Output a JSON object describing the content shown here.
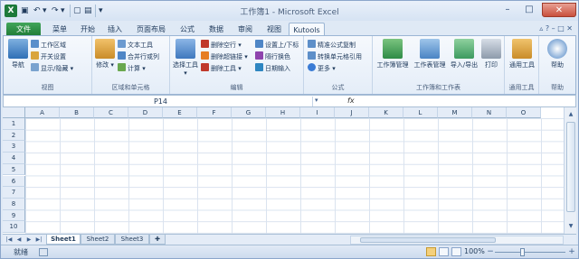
{
  "window": {
    "title": "工作簿1 - Microsoft Excel"
  },
  "titlebar": {
    "app_icon": "excel-icon",
    "undo": "↶",
    "redo": "↷",
    "minimize": "–",
    "maximize": "□",
    "close": "✕"
  },
  "tabs": [
    "文件",
    "菜单",
    "开始",
    "插入",
    "页面布局",
    "公式",
    "数据",
    "审阅",
    "视图",
    "Kutools"
  ],
  "ribbon": {
    "view_group": {
      "label": "视图",
      "big": "导航",
      "items": [
        "工作区域",
        "开关设置",
        "显示/隐藏"
      ]
    },
    "range_group": {
      "label": "区域和单元格",
      "big": "修改",
      "items": [
        "文本工具",
        "合并行或列",
        "计算"
      ]
    },
    "edit_group": {
      "label": "编辑",
      "big": "选择工具",
      "items": [
        "删除空行",
        "删除超链接",
        "删除工具",
        "设置上/下标",
        "隔行换色",
        "日期输入"
      ]
    },
    "formula_group": {
      "label": "公式",
      "items": [
        "精准公式复制",
        "转换单元格引用",
        "更多"
      ]
    },
    "workbook_group": {
      "label": "工作簿和工作表",
      "items": [
        "工作簿管理",
        "工作表管理",
        "导入/导出",
        "打印"
      ]
    },
    "general_group": {
      "label": "通用工具",
      "items": [
        "通用工具"
      ]
    },
    "help_group": {
      "label": "帮助",
      "items": [
        "帮助"
      ]
    }
  },
  "formula_bar": {
    "name_box": "P14",
    "fx": "fx"
  },
  "grid": {
    "columns": [
      "A",
      "B",
      "C",
      "D",
      "E",
      "F",
      "G",
      "H",
      "I",
      "J",
      "K",
      "L",
      "M",
      "N",
      "O"
    ],
    "rows": [
      "1",
      "2",
      "3",
      "4",
      "5",
      "6",
      "7",
      "8",
      "9",
      "10"
    ]
  },
  "sheets": [
    "Sheet1",
    "Sheet2",
    "Sheet3"
  ],
  "status": {
    "mode": "就绪",
    "zoom": "100%"
  },
  "colors": {
    "file_tab": "#2e8b46",
    "ribbon_bg": "#f6f9fd",
    "accent": "#1e395b"
  }
}
